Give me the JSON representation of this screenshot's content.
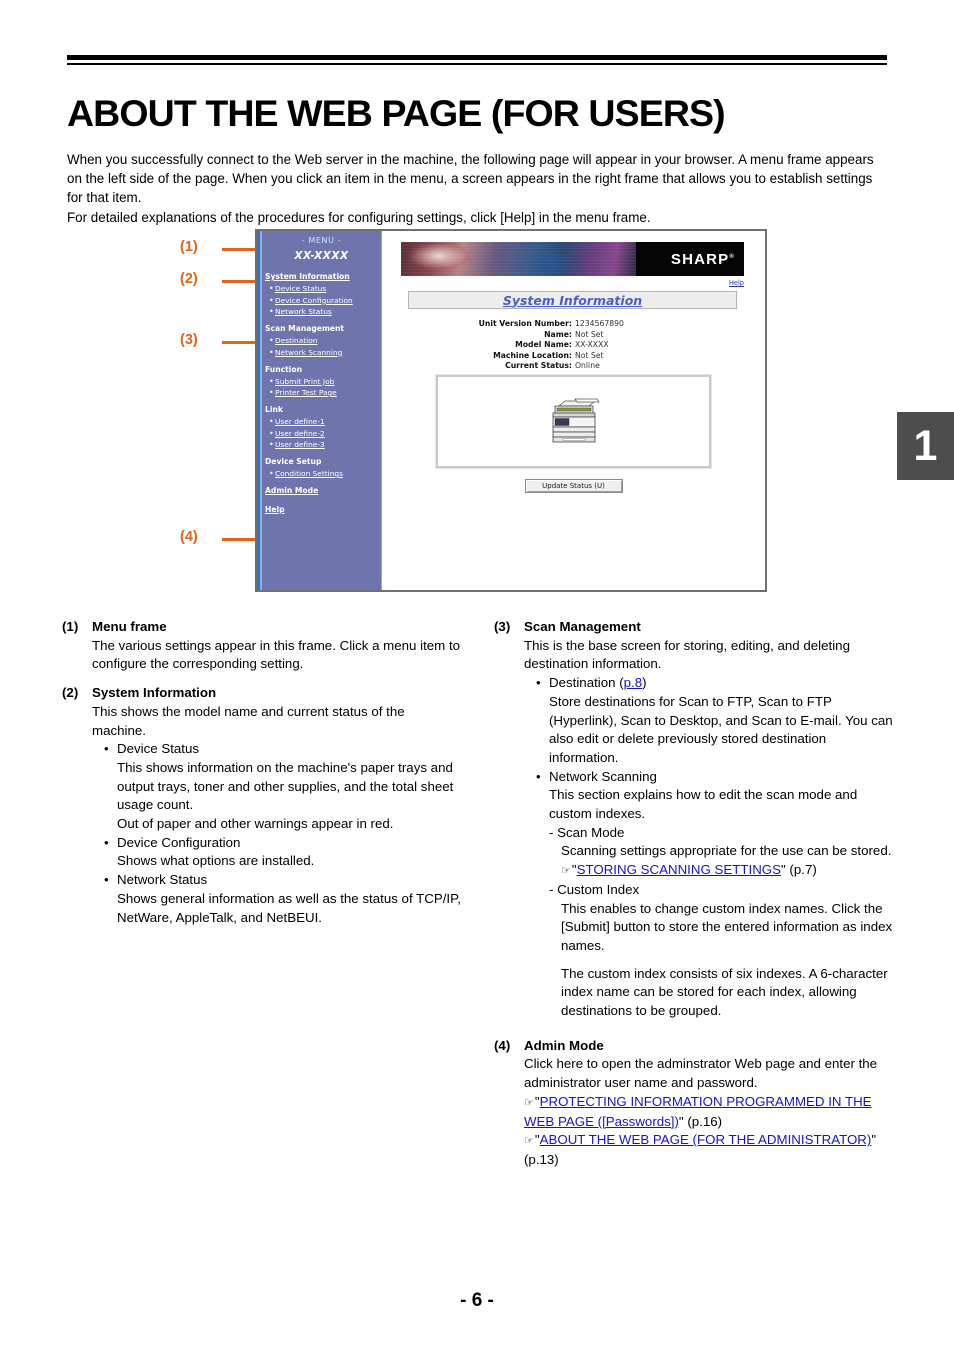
{
  "page": {
    "title": "ABOUT THE WEB PAGE (FOR USERS)",
    "intro": "When you successfully connect to the Web server in the machine, the following page will appear in your browser. A menu frame appears on the left side of the page. When you click an item in the menu, a screen appears in the right frame that allows you to establish settings for that item.\nFor detailed explanations of the procedures for configuring settings, click [Help] in the menu frame.",
    "chapter_tab": "1",
    "footer": "- 6 -"
  },
  "callouts": {
    "c1": "(1)",
    "c2": "(2)",
    "c3": "(3)",
    "c4": "(4)",
    "color": "#e2631b"
  },
  "screenshot": {
    "menu": {
      "title": "- MENU -",
      "model": "XX-XXXX",
      "groups": [
        {
          "head": "System Information",
          "head_linked": true,
          "items": [
            "Device Status",
            "Device Configuration",
            "Network Status"
          ]
        },
        {
          "head": "Scan Management",
          "head_linked": false,
          "items": [
            "Destination",
            "Network Scanning"
          ]
        },
        {
          "head": "Function",
          "head_linked": false,
          "items": [
            "Submit Print Job",
            "Printer Test Page"
          ]
        },
        {
          "head": "Link",
          "head_linked": false,
          "items": [
            "User define-1",
            "User define-2",
            "User define-3"
          ]
        },
        {
          "head": "Device Setup",
          "head_linked": false,
          "items": [
            "Condition Settings"
          ]
        }
      ],
      "admin_mode": "Admin Mode",
      "help": "Help",
      "bg_color": "#6f74ad"
    },
    "right": {
      "brand": "SHARP",
      "help_link": "Help",
      "heading": "System Information",
      "info": [
        {
          "label": "Unit Version Number:",
          "value": "1234567890"
        },
        {
          "label": "Name:",
          "value": "Not Set"
        },
        {
          "label": "Model Name:",
          "value": "XX-XXXX"
        },
        {
          "label": "Machine Location:",
          "value": "Not Set"
        },
        {
          "label": "Current Status:",
          "value": "Online"
        }
      ],
      "update_button": "Update Status (U)"
    }
  },
  "descriptions": {
    "left": [
      {
        "num": "(1)",
        "title": "Menu frame",
        "body": "The various settings appear in this frame. Click a menu item to configure the corresponding setting."
      },
      {
        "num": "(2)",
        "title": "System Information",
        "body": "This shows the model name and current status of the machine.",
        "bullets": [
          {
            "label": "Device Status",
            "paras": [
              "This shows information on the machine's paper trays and output trays, toner and other supplies, and the total sheet usage count.",
              "Out of paper and other warnings appear in red."
            ]
          },
          {
            "label": "Device Configuration",
            "paras": [
              "Shows what options are installed."
            ]
          },
          {
            "label": "Network Status",
            "paras": [
              "Shows general information as well as the status of TCP/IP, NetWare, AppleTalk, and NetBEUI."
            ]
          }
        ]
      }
    ],
    "right": [
      {
        "num": "(3)",
        "title": "Scan Management",
        "body": "This is the base screen for storing, editing, and deleting destination information.",
        "destination_label": "Destination (",
        "destination_link": "p.8",
        "destination_label_close": ")",
        "destination_body": "Store destinations for Scan to FTP, Scan to FTP (Hyperlink), Scan to Desktop, and Scan to E-mail. You can also edit or delete previously stored destination information.",
        "netscan_label": "Network Scanning",
        "netscan_body": "This section explains how to edit the scan mode and custom indexes.",
        "scanmode_label": "- Scan Mode",
        "scanmode_body": "Scanning settings appropriate for the use can be stored.",
        "scanmode_ref_open": "\"",
        "scanmode_ref_link": "STORING SCANNING SETTINGS",
        "scanmode_ref_close": "\" (p.7)",
        "custom_label": "- Custom Index",
        "custom_body1": "This enables to change custom index names. Click the [Submit] button to store the entered information as index names.",
        "custom_body2": "The custom index consists of six indexes. A 6-character index name can be stored for each index, allowing destinations to be grouped."
      },
      {
        "num": "(4)",
        "title": "Admin Mode",
        "body": "Click here to open the adminstrator Web page and enter the administrator user name and password.",
        "ref1_link": "PROTECTING INFORMATION PROGRAMMED IN THE WEB PAGE ([Passwords])",
        "ref1_page": "\" (p.16)",
        "ref2_link": "ABOUT THE WEB PAGE (FOR THE ADMINISTRATOR)",
        "ref2_page": "\" (p.13)"
      }
    ]
  }
}
